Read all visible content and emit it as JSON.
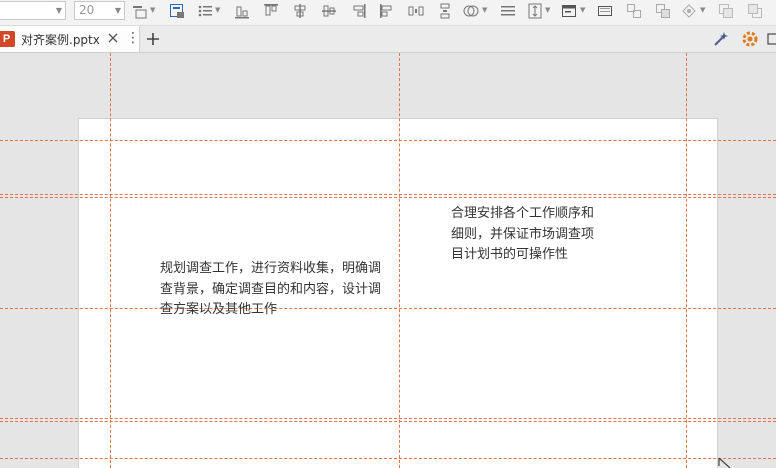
{
  "toolbar": {
    "font_name_value": "",
    "font_size_value": "20",
    "icons": [
      "paragraph-shape-icon",
      "text-box-icon",
      "bullet-list-icon",
      "align-bottom-icon",
      "align-top-icon",
      "align-center-vertical-icon",
      "align-middle-icon",
      "align-right-icon",
      "align-left-icon",
      "distribute-horizontal-icon",
      "distribute-vertical-icon",
      "shape-fill-icon",
      "line-spacing-icon",
      "paragraph-spacing-icon",
      "layout-icon",
      "slide-size-icon",
      "group-icon",
      "ungroup-icon",
      "effects-icon",
      "bring-forward-icon",
      "send-backward-icon"
    ]
  },
  "tabbar": {
    "app_badge": "P",
    "document_tab": "对齐案例.pptx",
    "new_tab_symbol": "+",
    "menu_symbol": "⋮"
  },
  "slide": {
    "textbox_left_lines": [
      "规划调查工作，进行资料收集，明确调",
      "查背景，确定调查目的和内容，设计调",
      "查方案以及其他工作"
    ],
    "textbox_right_lines": [
      "合理安排各个工作顺序和",
      "细则，并保证市场调查项",
      "目计划书的可操作性"
    ]
  },
  "colors": {
    "guide": "#e2734d",
    "app_accent": "#d24726",
    "settings_accent": "#e07a1f"
  }
}
